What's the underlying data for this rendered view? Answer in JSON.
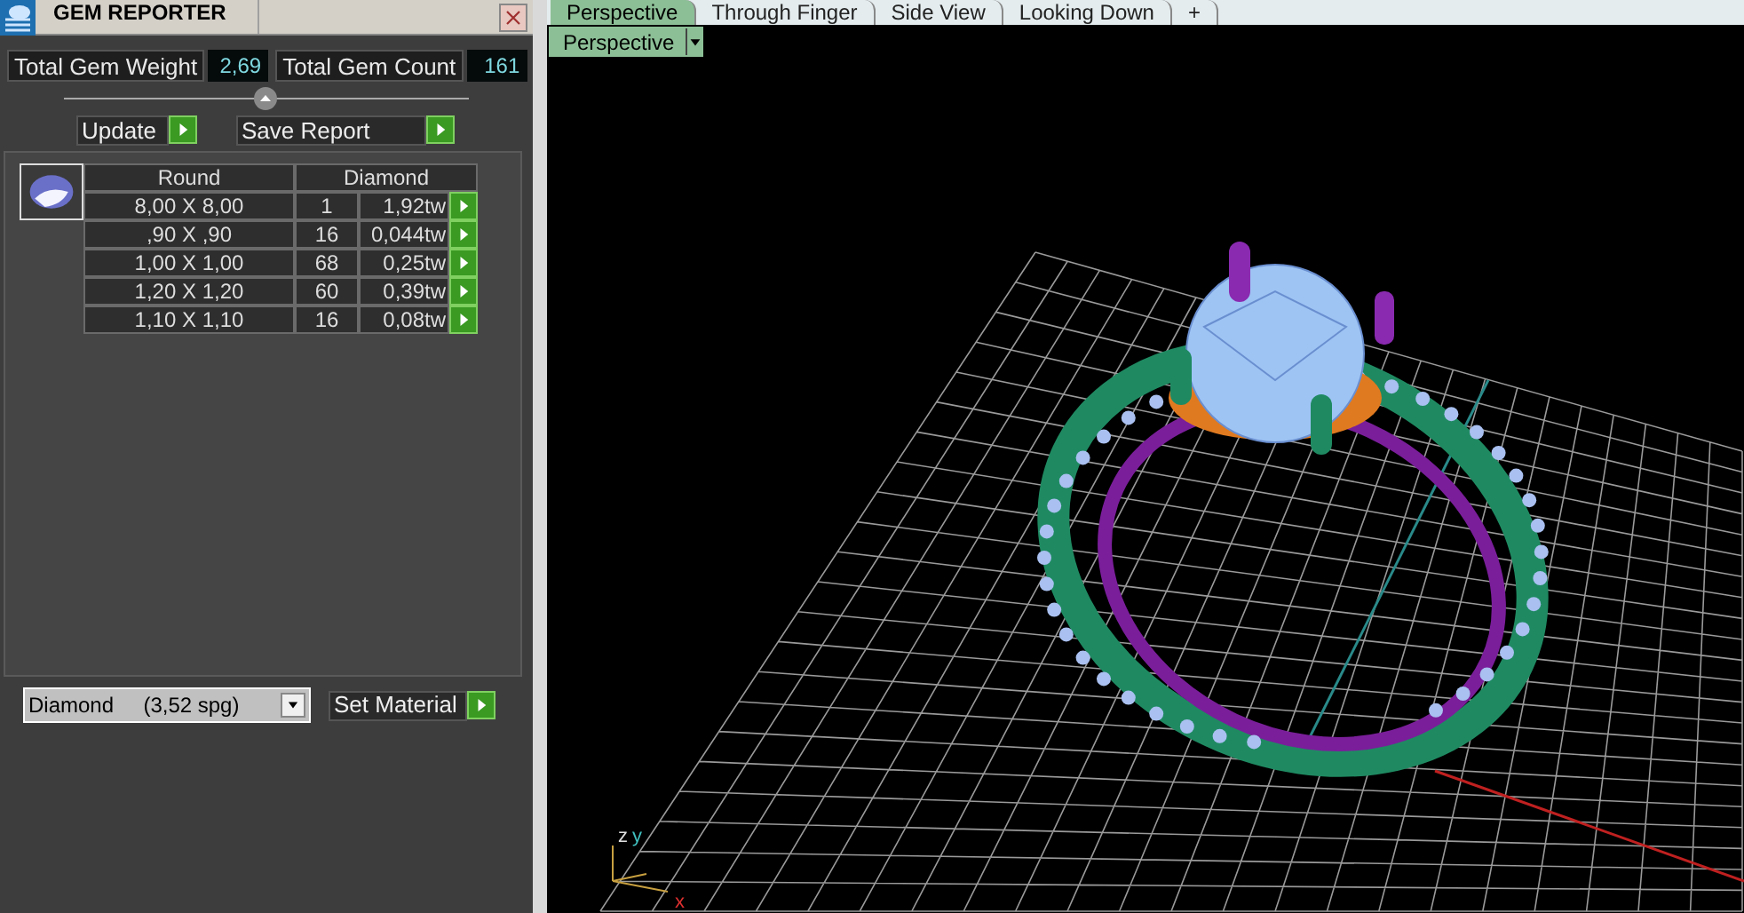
{
  "panel": {
    "title": "GEM REPORTER",
    "totals": [
      {
        "label": "Total Gem Weight",
        "value": "2,69"
      },
      {
        "label": "Total Gem Count",
        "value": "161"
      }
    ],
    "buttons": [
      {
        "label": "Update"
      },
      {
        "label": "Save Report"
      }
    ],
    "table": {
      "columns": [
        "Round",
        "Diamond"
      ],
      "rows": [
        {
          "size": "8,00 X 8,00",
          "count": "1",
          "weight": "1,92tw"
        },
        {
          "size": ",90 X ,90",
          "count": "16",
          "weight": "0,044tw"
        },
        {
          "size": "1,00 X 1,00",
          "count": "68",
          "weight": "0,25tw"
        },
        {
          "size": "1,20 X 1,20",
          "count": "60",
          "weight": "0,39tw"
        },
        {
          "size": "1,10 X 1,10",
          "count": "16",
          "weight": "0,08tw"
        }
      ]
    },
    "material": {
      "value": "Diamond     (3,52 spg)"
    },
    "set_material": {
      "label": "Set Material"
    }
  },
  "viewport": {
    "tabs": [
      {
        "label": "Perspective",
        "selected": true
      },
      {
        "label": "Through Finger",
        "selected": false
      },
      {
        "label": "Side View",
        "selected": false
      },
      {
        "label": "Looking Down",
        "selected": false
      },
      {
        "label": "+",
        "selected": false
      }
    ],
    "view_menu": {
      "value": "Perspective"
    },
    "axes": [
      "z",
      "y",
      "x"
    ]
  }
}
